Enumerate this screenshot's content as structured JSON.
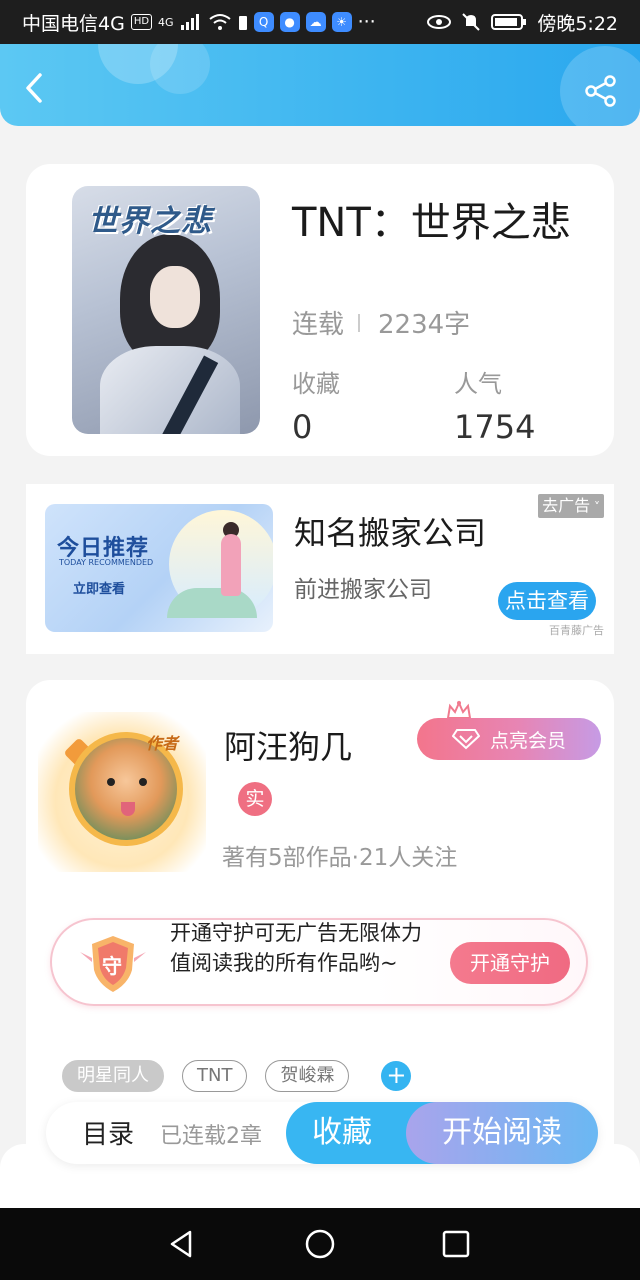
{
  "status_bar": {
    "carrier": "中国电信4G",
    "hd": "HD",
    "network": "4G",
    "time": "傍晚5:22"
  },
  "header": {
    "back_icon": "chevron-left-icon",
    "share_icon": "share-icon",
    "color": "#3cb4f0"
  },
  "book": {
    "cover_title": "世界之悲",
    "title": "TNT：世界之悲",
    "status": "连载",
    "word_count": "2234字",
    "collect_label": "收藏",
    "collect_value": "0",
    "popularity_label": "人气",
    "popularity_value": "1754"
  },
  "ad": {
    "image_title": "今日推荐",
    "image_subtitle": "TODAY RECOMMENDED",
    "image_button": "立即查看",
    "title": "知名搬家公司",
    "subtitle": "前进搬家公司",
    "close_label": "去广告",
    "cta_label": "点击查看",
    "source": "百青藤广告"
  },
  "author": {
    "avatar_badge": "作者",
    "name": "阿汪狗几",
    "vip_label": "点亮会员",
    "real_badge": "实",
    "stats": "著有5部作品·21人关注",
    "guard_icon_text": "守",
    "guard_text": "开通守护可无广告无限体力值阅读我的所有作品哟~",
    "guard_button": "开通守护"
  },
  "tags": [
    "明星同人",
    "TNT",
    "贺峻霖"
  ],
  "action_bar": {
    "toc_label": "目录",
    "chapter_info": "已连载2章",
    "favorite_label": "收藏",
    "read_label": "开始阅读"
  },
  "colors": {
    "accent_blue": "#38b6f2",
    "pink": "#f06a82",
    "purple": "#a9a4ec"
  }
}
